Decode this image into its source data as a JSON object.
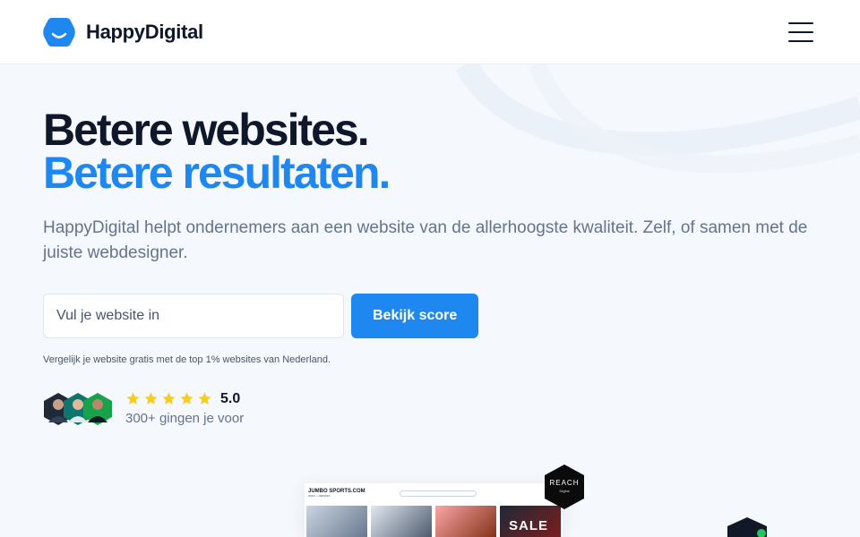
{
  "header": {
    "brand_name": "HappyDigital",
    "logo_icon": "smile-hexagon-icon",
    "menu_icon": "hamburger-menu-icon"
  },
  "hero": {
    "title_line1": "Betere websites.",
    "title_line2": "Betere resultaten.",
    "subtitle": "HappyDigital helpt ondernemers aan een website van de allerhoogste kwaliteit. Zelf, of samen met de juiste webdesigner.",
    "input_placeholder": "Vul je website in",
    "button_label": "Bekijk score",
    "helper_text": "Vergelijk je website gratis met de top 1% websites van Nederland."
  },
  "social_proof": {
    "stars": 5,
    "rating": "5.0",
    "text": "300+ gingen je voor"
  },
  "preview": {
    "site_logo_line1": "JUMBO SPORTS.COM",
    "site_logo_line2": "GOLF + HOCKEY",
    "sale_label": "SALE",
    "badge_title": "REACH",
    "badge_subtitle": "Digital"
  },
  "colors": {
    "brand_blue": "#1e88f0",
    "heading_dark": "#0f172a",
    "text_muted": "#64748b",
    "star_yellow": "#facc15",
    "background": "#f5f8fc"
  }
}
